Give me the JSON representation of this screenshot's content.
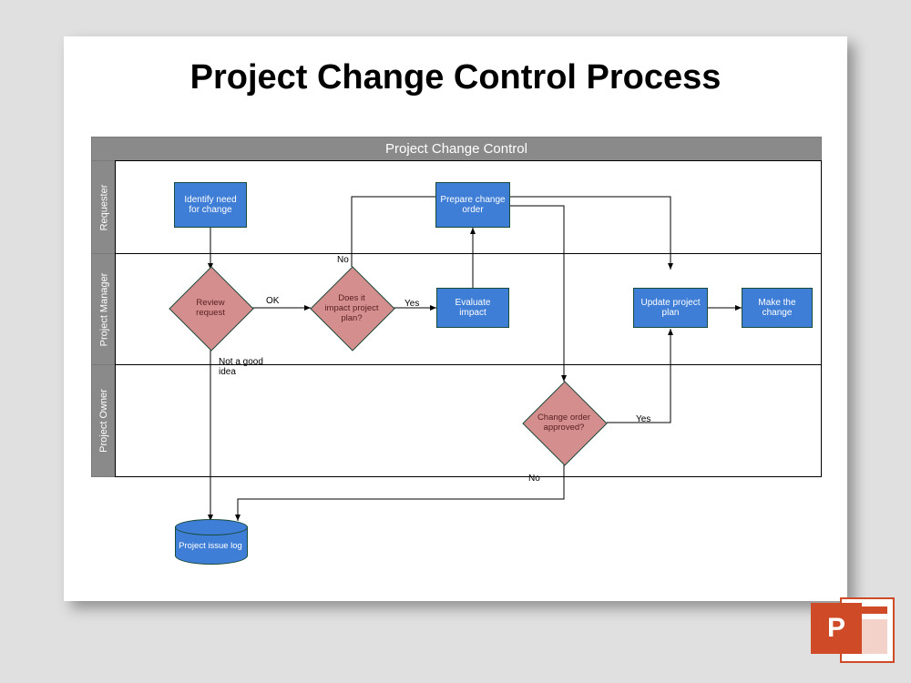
{
  "title": "Project Change Control Process",
  "swim_header": "Project Change Control",
  "lanes": {
    "requester": "Requester",
    "project_manager": "Project Manager",
    "project_owner": "Project Owner"
  },
  "nodes": {
    "identify": "Identify need for change",
    "prepare": "Prepare change order",
    "review": "Review request",
    "impact_q": "Does it impact project plan?",
    "evaluate": "Evaluate impact",
    "update": "Update project plan",
    "make": "Make the change",
    "approved_q": "Change order approved?",
    "log": "Project issue log"
  },
  "edges": {
    "ok": "OK",
    "no": "No",
    "yes": "Yes",
    "not_good": "Not a good idea",
    "yes2": "Yes",
    "no2": "No"
  },
  "badge": {
    "letter": "P"
  }
}
